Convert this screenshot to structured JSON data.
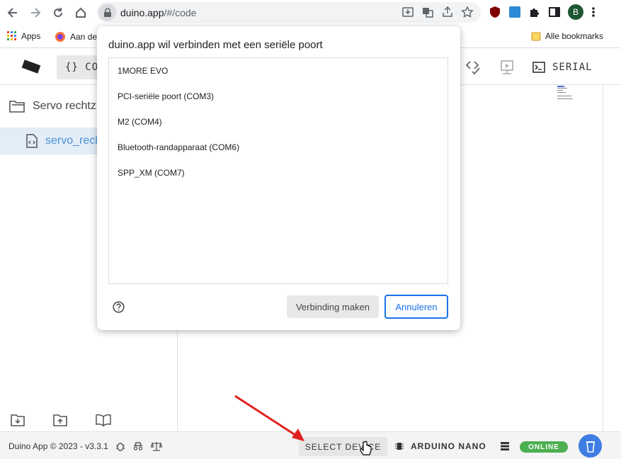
{
  "browser": {
    "url_host": "duino.app",
    "url_path": "/#/code",
    "bookmarks": {
      "apps": "Apps",
      "aan": "Aan de",
      "alle": "Alle bookmarks"
    },
    "profile_initial": "B"
  },
  "app": {
    "tabs": {
      "code": "{} CO",
      "serial": "SERIAL"
    },
    "project_name": "Servo rechtz",
    "file_name": "servo_rech"
  },
  "dialog": {
    "title": "duino.app wil verbinden met een seriële poort",
    "ports": [
      "1MORE EVO",
      "PCI-seriële poort (COM3)",
      "M2 (COM4)",
      "Bluetooth-randapparaat (COM6)",
      "SPP_XM (COM7)"
    ],
    "connect_label": "Verbinding maken",
    "cancel_label": "Annuleren"
  },
  "status": {
    "copyright": "Duino App © 2023 - v3.3.1",
    "select_device": "SELECT DEVICE",
    "board": "ARDUINO NANO",
    "online": "ONLINE"
  },
  "colors": {
    "accent": "#1a73e8",
    "online": "#4caf50",
    "cup": "#3d7de4",
    "arrow": "#e02020"
  }
}
